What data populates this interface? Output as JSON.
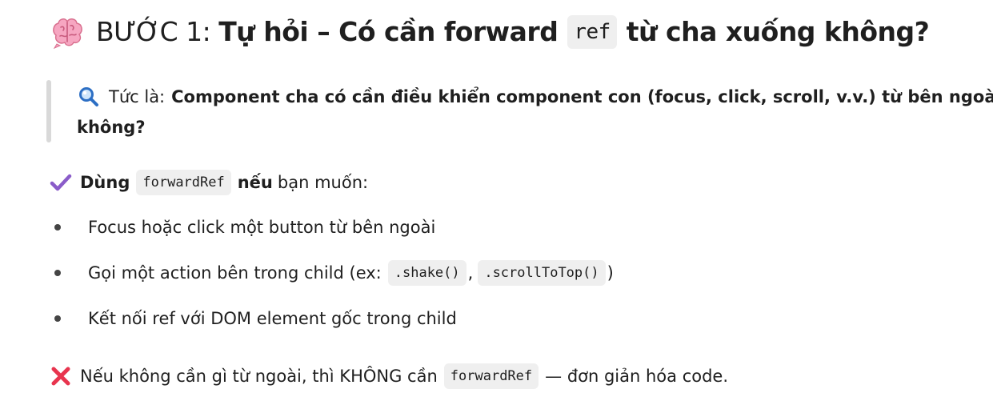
{
  "heading": {
    "icon": "brain-icon",
    "prefix": "BƯỚC 1:",
    "bold_part1": "Tự hỏi – Có cần forward",
    "code": "ref",
    "bold_part2": "từ cha xuống không?"
  },
  "quote": {
    "icon": "magnifier-icon",
    "label": "Tức là:",
    "line1_bold": "Component cha có cần điều khiển component con (focus, click, scroll, v.v.) từ bên ngoài",
    "line2_bold": "không?"
  },
  "check": {
    "icon": "checkmark-icon",
    "icon_color": "#8a5cc9",
    "bold_word": "Dùng",
    "code": "forwardRef",
    "bold_after": "nếu",
    "tail": "bạn muốn:"
  },
  "bullets": {
    "item1": "Focus hoặc click một button từ bên ngoài",
    "item2_text": "Gọi một action bên trong child (ex:",
    "item2_code1": ".shake()",
    "item2_sep": ",",
    "item2_code2": ".scrollToTop()",
    "item2_close": ")",
    "item3": "Kết nối ref với DOM element gốc trong child"
  },
  "cross": {
    "icon": "cross-icon",
    "icon_color": "#e8344e",
    "text_before": "Nếu không cần gì từ ngoài, thì KHÔNG cần",
    "code": "forwardRef",
    "text_after": "— đơn giản hóa code."
  }
}
